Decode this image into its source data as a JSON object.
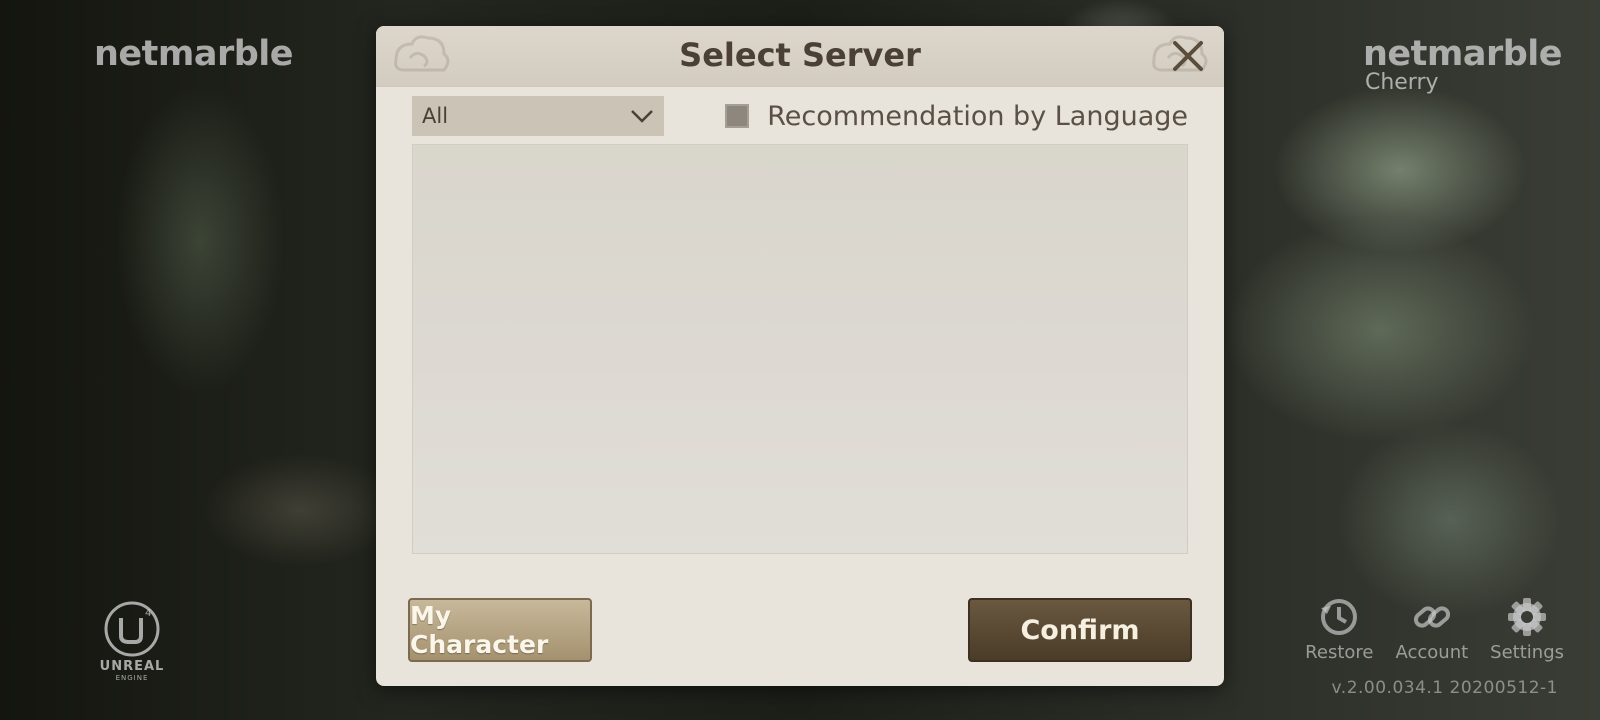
{
  "brand": {
    "left": "netmarble",
    "right_name": "netmarble",
    "right_sub": "Cherry"
  },
  "engine_logo": {
    "line1": "UNREAL",
    "line2": "ENGINE"
  },
  "dialog": {
    "title": "Select Server",
    "filter_value": "All",
    "recommend_label": "Recommendation by Language",
    "recommend_checked": false,
    "my_character_label": "My Character",
    "confirm_label": "Confirm"
  },
  "footer": {
    "restore_label": "Restore",
    "account_label": "Account",
    "settings_label": "Settings",
    "version": "v.2.00.034.1  20200512-1"
  },
  "colors": {
    "dialog_bg": "#e8e4dc",
    "confirm_bg": "#4a3c28",
    "mychar_bg": "#a4916f",
    "title_text": "#4a4033"
  },
  "icons": {
    "close": "close-icon",
    "dropdown": "chevron-down-icon",
    "restore": "restore-clock-icon",
    "account": "link-icon",
    "settings": "gear-icon",
    "engine": "unreal-engine-logo"
  }
}
